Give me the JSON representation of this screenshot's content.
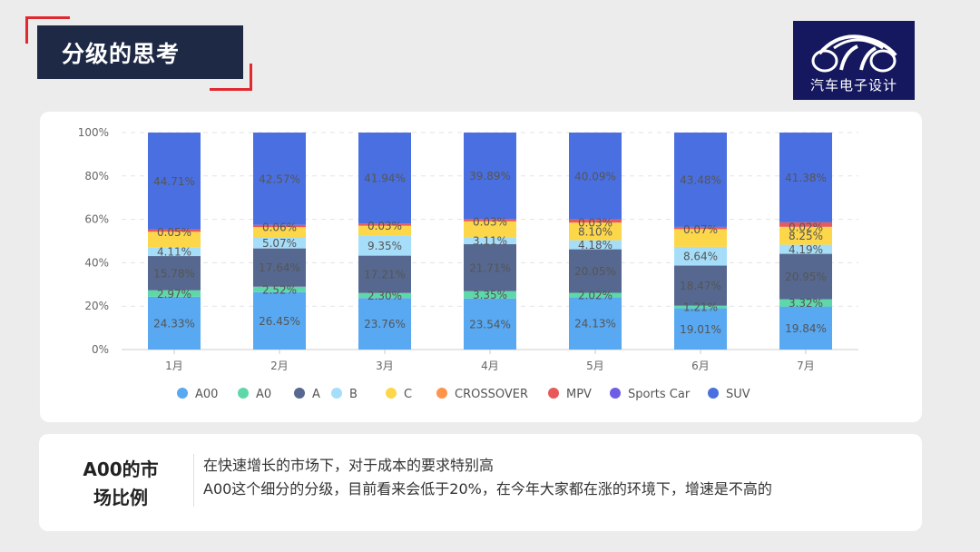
{
  "header": {
    "title": "分级的思考"
  },
  "logo": {
    "name": "car-logo",
    "text": "汽车电子设计"
  },
  "colors": {
    "title_bg": "#1e2a45",
    "accent_red": "#e0282e",
    "logo_bg": "#15185e"
  },
  "chart_data": {
    "type": "bar",
    "stacked": true,
    "title": "",
    "xlabel": "",
    "ylabel": "",
    "ylim": [
      0,
      100
    ],
    "y_ticks": [
      "0%",
      "20%",
      "40%",
      "60%",
      "80%",
      "100%"
    ],
    "y_tick_values": [
      0,
      20,
      40,
      60,
      80,
      100
    ],
    "grid": true,
    "legend_position": "bottom",
    "categories": [
      "1月",
      "2月",
      "3月",
      "4月",
      "5月",
      "6月",
      "7月"
    ],
    "series": [
      {
        "name": "A00",
        "color": "#58a8f2",
        "values": [
          24.33,
          26.45,
          23.76,
          23.54,
          24.13,
          19.01,
          19.84
        ],
        "labels": [
          "24.33%",
          "26.45%",
          "23.76%",
          "23.54%",
          "24.13%",
          "19.01%",
          "19.84%"
        ]
      },
      {
        "name": "A0",
        "color": "#5fd8a9",
        "values": [
          2.97,
          2.52,
          2.3,
          3.35,
          2.02,
          1.21,
          3.32
        ],
        "labels": [
          "2.97%",
          "2.52%",
          "2.30%",
          "3.35%",
          "2.02%",
          "1.21%",
          "3.32%"
        ]
      },
      {
        "name": "A",
        "color": "#56688f",
        "values": [
          15.78,
          17.64,
          17.21,
          21.71,
          20.05,
          18.47,
          20.95
        ],
        "labels": [
          "15.78%",
          "17.64%",
          "17.21%",
          "21.71%",
          "20.05%",
          "18.47%",
          "20.95%"
        ]
      },
      {
        "name": "B",
        "color": "#a6defa",
        "values": [
          4.11,
          5.07,
          9.35,
          3.11,
          4.18,
          8.64,
          4.19
        ],
        "labels": [
          "4.11%",
          "5.07%",
          "9.35%",
          "3.11%",
          "4.18%",
          "8.64%",
          "4.19%"
        ]
      },
      {
        "name": "C",
        "color": "#fdd74a",
        "values": [
          7.05,
          4.69,
          4.41,
          7.37,
          8.1,
          8.12,
          8.25
        ],
        "labels": [
          "",
          "",
          "",
          "",
          "8.10%",
          "",
          "8.25%"
        ]
      },
      {
        "name": "CROSSOVER",
        "color": "#fd944b",
        "values": [
          0.05,
          0.06,
          0.03,
          0.03,
          0.03,
          0.07,
          0.02
        ],
        "labels": [
          "0.05%",
          "0.06%",
          "0.03%",
          "0.03%",
          "0.03%",
          "0.07%",
          "0.02%"
        ]
      },
      {
        "name": "MPV",
        "color": "#e85a5a",
        "values": [
          1.0,
          1.0,
          1.0,
          1.0,
          1.4,
          1.0,
          2.05
        ],
        "labels": [
          "",
          "",
          "",
          "",
          "",
          "",
          ""
        ]
      },
      {
        "name": "Sports Car",
        "color": "#6e5ee6",
        "values": [
          0,
          0,
          0,
          0,
          0,
          0,
          0
        ],
        "labels": [
          "",
          "",
          "",
          "",
          "",
          "",
          ""
        ]
      },
      {
        "name": "SUV",
        "color": "#4a6fe0",
        "values": [
          44.71,
          42.57,
          41.94,
          39.89,
          40.09,
          43.48,
          41.38
        ],
        "labels": [
          "44.71%",
          "42.57%",
          "41.94%",
          "39.89%",
          "40.09%",
          "43.48%",
          "41.38%"
        ]
      }
    ]
  },
  "note": {
    "title_line1": "A00的市",
    "title_line2": "场比例",
    "line1": "在快速增长的市场下，对于成本的要求特别高",
    "line2": "A00这个细分的分级，目前看来会低于20%，在今年大家都在涨的环境下，增速是不高的"
  }
}
